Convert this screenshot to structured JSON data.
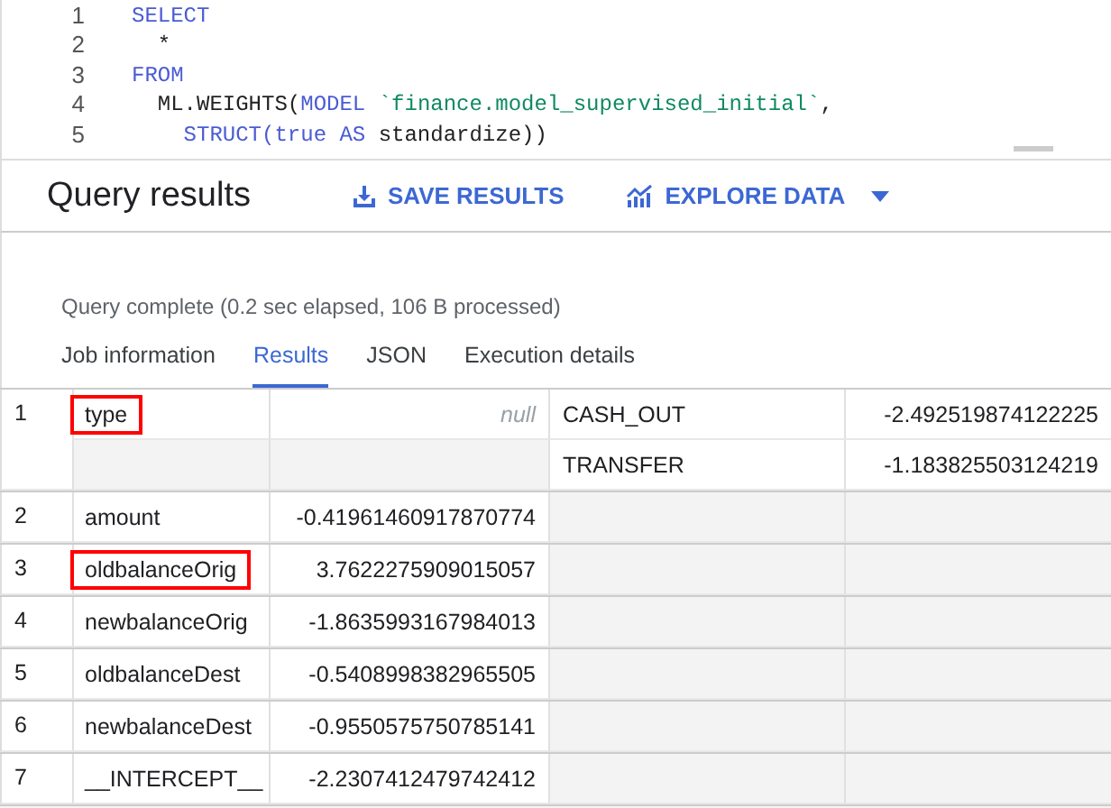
{
  "editor": {
    "lines": [
      {
        "number": "1",
        "tokens": [
          {
            "kind": "keyword",
            "text": "SELECT"
          }
        ]
      },
      {
        "number": "2",
        "tokens": [
          {
            "kind": "plain",
            "text": "  *"
          }
        ]
      },
      {
        "number": "3",
        "tokens": [
          {
            "kind": "keyword",
            "text": "FROM"
          }
        ]
      },
      {
        "number": "4",
        "tokens": [
          {
            "kind": "plain",
            "text": "  ML.WEIGHTS("
          },
          {
            "kind": "keyword",
            "text": "MODEL"
          },
          {
            "kind": "string",
            "text": " `finance.model_supervised_initial`"
          },
          {
            "kind": "plain",
            "text": ","
          }
        ]
      },
      {
        "number": "5",
        "tokens": [
          {
            "kind": "keyword",
            "text": "    STRUCT(true AS"
          },
          {
            "kind": "plain",
            "text": " standardize))"
          }
        ]
      }
    ]
  },
  "results_header": {
    "title": "Query results",
    "actions": [
      {
        "kind": "save",
        "label": "SAVE RESULTS"
      },
      {
        "kind": "explore",
        "label": "EXPLORE DATA"
      }
    ]
  },
  "status": "Query complete (0.2 sec elapsed, 106 B processed)",
  "tabs": [
    {
      "label": "Job information",
      "selected": false
    },
    {
      "label": "Results",
      "selected": true
    },
    {
      "label": "JSON",
      "selected": false
    },
    {
      "label": "Execution details",
      "selected": false
    }
  ],
  "table": {
    "rows": [
      {
        "number": "1",
        "feature": "type",
        "highlighted": true,
        "weight": null,
        "null_label": "null",
        "category_weights": [
          {
            "category": "CASH_OUT",
            "weight": "-2.492519874122225"
          },
          {
            "category": "TRANSFER",
            "weight": "-1.183825503124219"
          }
        ]
      },
      {
        "number": "2",
        "feature": "amount",
        "highlighted": false,
        "weight": "-0.41961460917870774"
      },
      {
        "number": "3",
        "feature": "oldbalanceOrig",
        "highlighted": true,
        "weight": "3.7622275909015057"
      },
      {
        "number": "4",
        "feature": "newbalanceOrig",
        "highlighted": false,
        "weight": "-1.8635993167984013"
      },
      {
        "number": "5",
        "feature": "oldbalanceDest",
        "highlighted": false,
        "weight": "-0.5408998382965505"
      },
      {
        "number": "6",
        "feature": "newbalanceDest",
        "highlighted": false,
        "weight": "-0.9550575750785141"
      },
      {
        "number": "7",
        "feature": "__INTERCEPT__",
        "highlighted": false,
        "weight": "-2.2307412479742412"
      }
    ]
  }
}
